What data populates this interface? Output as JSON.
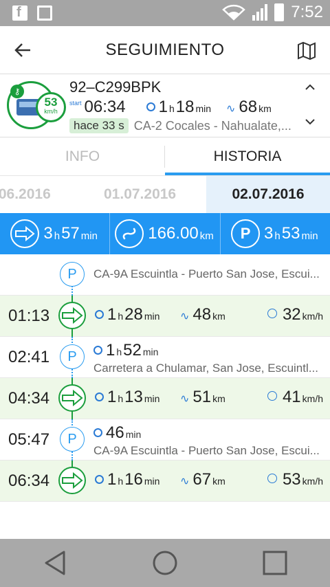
{
  "status_bar": {
    "time": "7:52",
    "icons": [
      "facebook-icon",
      "image-icon",
      "wifi-icon",
      "signal-icon",
      "battery-icon"
    ]
  },
  "app_bar": {
    "title": "SEGUIMIENTO"
  },
  "vehicle": {
    "plate": "92–C299BPK",
    "speed": "53",
    "speed_unit": "km/h",
    "start_label": "start",
    "start_time": "06:34",
    "duration_h": "1",
    "duration_m": "18",
    "distance": "68",
    "unit_h": "h",
    "unit_min": "min",
    "unit_km": "km",
    "ago": "hace 33 s",
    "location": "CA-2 Cocales - Nahualate,..."
  },
  "tabs": [
    {
      "label": "INFO"
    },
    {
      "label": "HISTORIA"
    }
  ],
  "dates": [
    ".06.2016",
    "01.07.2016",
    "02.07.2016"
  ],
  "summary": {
    "drive_h": "3",
    "drive_m": "57",
    "distance": "166.00",
    "park_h": "3",
    "park_m": "53",
    "unit_h": "h",
    "unit_min": "min",
    "unit_km": "km"
  },
  "timeline": {
    "first_address": "CA-9A Escuintla - Puerto San Jose, Escui...",
    "rows": [
      {
        "time": "01:13",
        "dur_h": "1",
        "dur_m": "28",
        "dist": "48",
        "speed": "32"
      },
      {
        "time": "02:41",
        "dur_h": "1",
        "dur_m": "52",
        "address": "Carretera a Chulamar, San Jose, Escuintl..."
      },
      {
        "time": "04:34",
        "dur_h": "1",
        "dur_m": "13",
        "dist": "51",
        "speed": "41"
      },
      {
        "time": "05:47",
        "dur_m": "46",
        "address": "CA-9A Escuintla - Puerto San Jose, Escui..."
      },
      {
        "time": "06:34",
        "dur_h": "1",
        "dur_m": "16",
        "dist": "67",
        "speed": "53"
      }
    ],
    "unit_h": "h",
    "unit_min": "min",
    "unit_km": "km",
    "unit_speed": "km/h"
  },
  "colors": {
    "accent": "#2196f3",
    "drive_green": "#1b9e3d",
    "drive_bg": "#eef8e8"
  }
}
